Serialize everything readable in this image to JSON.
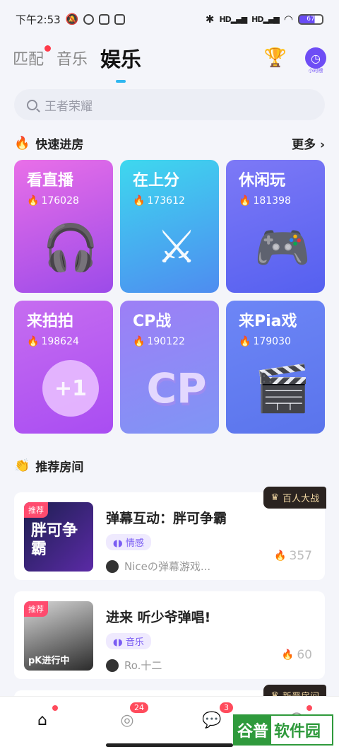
{
  "status_bar": {
    "time": "下午2:53",
    "network_label": "HD",
    "battery": "67"
  },
  "header": {
    "tabs": [
      {
        "label": "匹配",
        "has_dot": true
      },
      {
        "label": "音乐",
        "has_dot": false
      },
      {
        "label": "娱乐",
        "active": true
      }
    ],
    "trophy_icon": "trophy-icon",
    "avatar_caption": "小时榜"
  },
  "search": {
    "placeholder": "王者荣耀"
  },
  "quick_enter": {
    "title": "快速进房",
    "more_label": "更多",
    "cards": [
      {
        "title": "看直播",
        "count": "176028",
        "icon": "headphones-icon"
      },
      {
        "title": "在上分",
        "count": "173612",
        "icon": "crossed-swords-icon"
      },
      {
        "title": "休闲玩",
        "count": "181398",
        "icon": "gamepad-icon"
      },
      {
        "title": "来拍拍",
        "count": "198624",
        "icon": "coin-icon",
        "deco_text": "+1"
      },
      {
        "title": "CP战",
        "count": "190122",
        "icon": "cp-icon",
        "deco_text": "CP"
      },
      {
        "title": "来Pia戏",
        "count": "179030",
        "icon": "clapperboard-icon"
      }
    ]
  },
  "recommend": {
    "title": "推荐房间",
    "rooms": [
      {
        "badge": "百人大战",
        "rec_label": "推荐",
        "name": "弹幕互动：胖可争霸",
        "tag": "情感",
        "host": "Niceの弹幕游戏...",
        "heat": "357",
        "cover_text": "胖可争霸"
      },
      {
        "rec_label": "推荐",
        "name": "进来 听少爷弹唱!",
        "tag": "音乐",
        "host": "Ro.十二",
        "heat": "60",
        "cover_text": "pK进行中"
      }
    ],
    "peek_badge": "新晋房间"
  },
  "tabbar": {
    "messages_count": "24",
    "chat_count": "3"
  },
  "watermark": {
    "text1": "谷普",
    "text2": "软件园"
  },
  "colors": {
    "accent": "#6e4df5",
    "underline": "#2fb7f0",
    "badge_red": "#ff4b5c"
  }
}
